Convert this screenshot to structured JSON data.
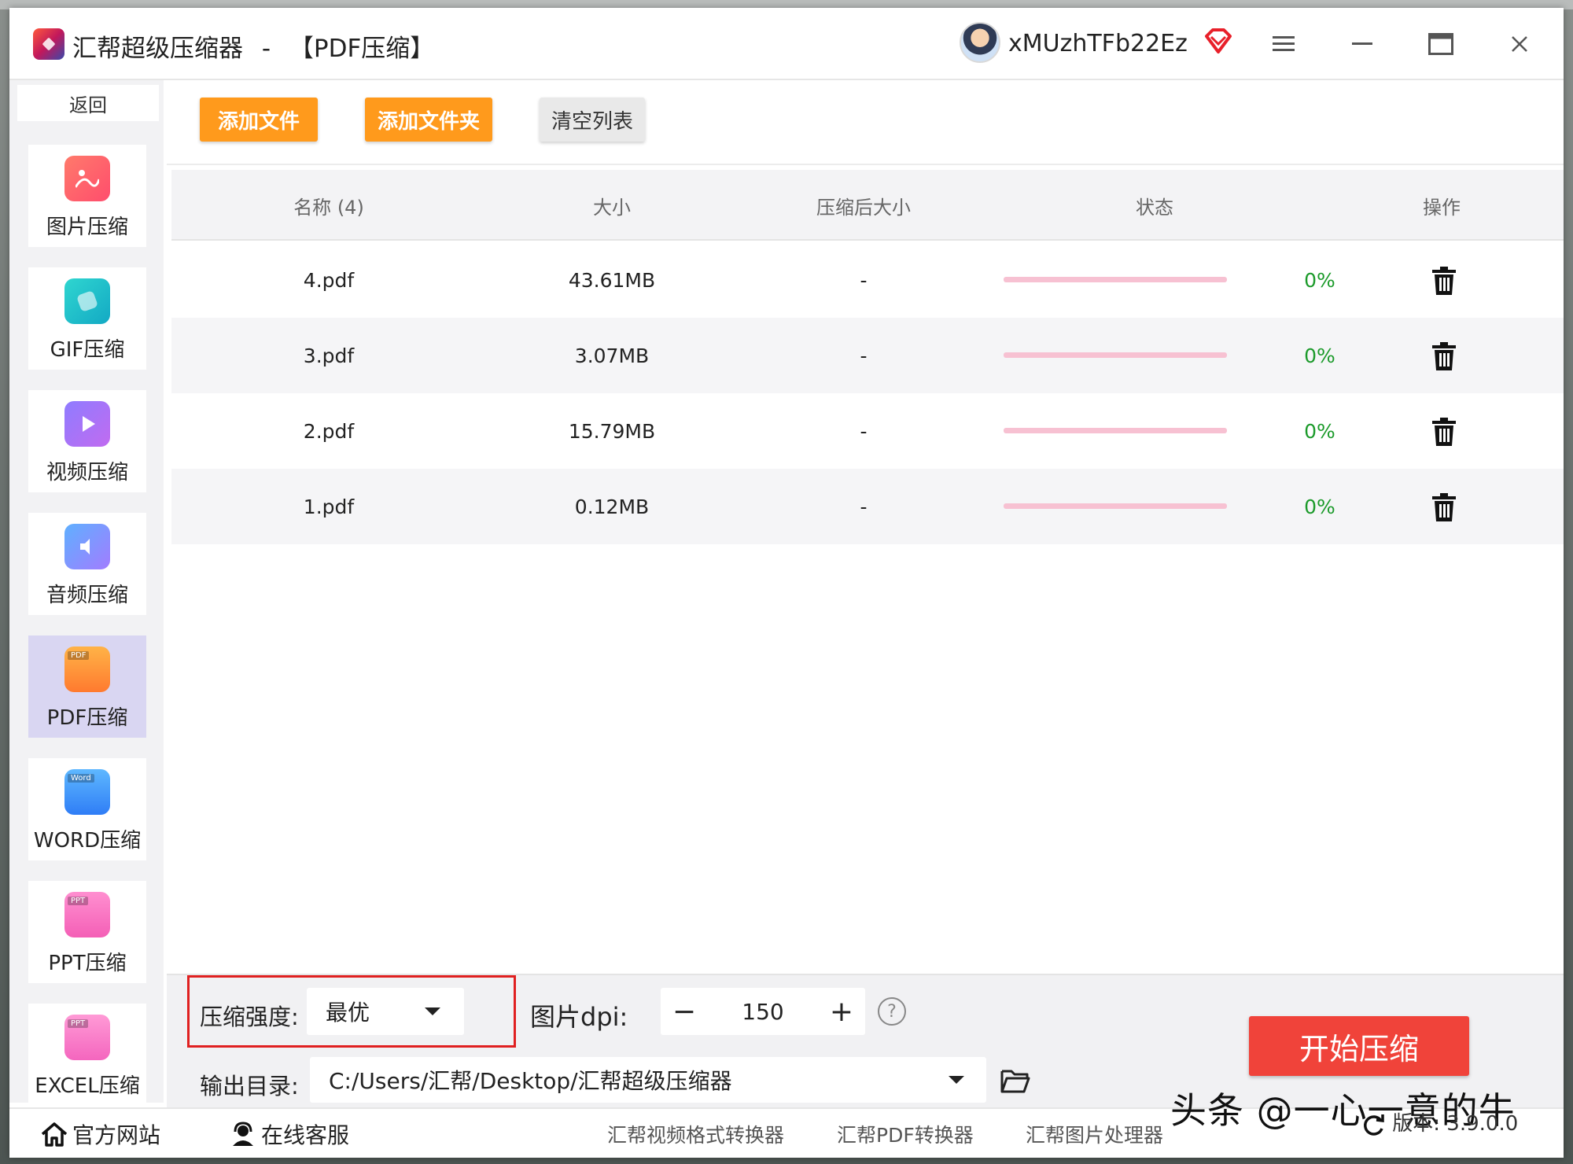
{
  "window": {
    "app_name": "汇帮超级压缩器",
    "separator": "-",
    "mode": "【PDF压缩】",
    "username": "xMUzhTFb22Ez"
  },
  "sidebar": {
    "back": "返回",
    "items": [
      {
        "label": "图片压缩",
        "icon": "image-icon"
      },
      {
        "label": "GIF压缩",
        "icon": "gif-icon"
      },
      {
        "label": "视频压缩",
        "icon": "video-icon"
      },
      {
        "label": "音频压缩",
        "icon": "audio-icon"
      },
      {
        "label": "PDF压缩",
        "icon": "pdf-icon",
        "tag": "PDF",
        "active": true
      },
      {
        "label": "WORD压缩",
        "icon": "word-icon",
        "tag": "Word"
      },
      {
        "label": "PPT压缩",
        "icon": "ppt-icon",
        "tag": "PPT"
      },
      {
        "label": "EXCEL压缩",
        "icon": "excel-icon",
        "tag": "PPT"
      }
    ]
  },
  "toolbar": {
    "add_file": "添加文件",
    "add_folder": "添加文件夹",
    "clear_list": "清空列表"
  },
  "table": {
    "headers": [
      "名称 (4)",
      "大小",
      "压缩后大小",
      "状态",
      "操作"
    ],
    "rows": [
      {
        "name": "4.pdf",
        "size": "43.61MB",
        "compressed": "-",
        "progress": 0,
        "percent": "0%"
      },
      {
        "name": "3.pdf",
        "size": "3.07MB",
        "compressed": "-",
        "progress": 0,
        "percent": "0%"
      },
      {
        "name": "2.pdf",
        "size": "15.79MB",
        "compressed": "-",
        "progress": 0,
        "percent": "0%"
      },
      {
        "name": "1.pdf",
        "size": "0.12MB",
        "compressed": "-",
        "progress": 0,
        "percent": "0%"
      }
    ]
  },
  "settings": {
    "strength_label": "压缩强度:",
    "strength_value": "最优",
    "dpi_label": "图片dpi:",
    "dpi_minus": "−",
    "dpi_value": "150",
    "dpi_plus": "+",
    "help": "?",
    "output_label": "输出目录:",
    "output_path": "C:/Users/汇帮/Desktop/汇帮超级压缩器",
    "start": "开始压缩"
  },
  "footer": {
    "website": "官方网站",
    "support": "在线客服",
    "links": [
      "汇帮视频格式转换器",
      "汇帮PDF转换器",
      "汇帮图片处理器"
    ],
    "watermark": "头条 @一心一意的牛",
    "version": "版本:  3.9.0.0"
  },
  "colors": {
    "accent_orange": "#ff9a1c",
    "start_red": "#f0433a",
    "progress_track": "#f7c1d2",
    "percent_green": "#1b9a2a",
    "highlight_red": "#e02020"
  }
}
